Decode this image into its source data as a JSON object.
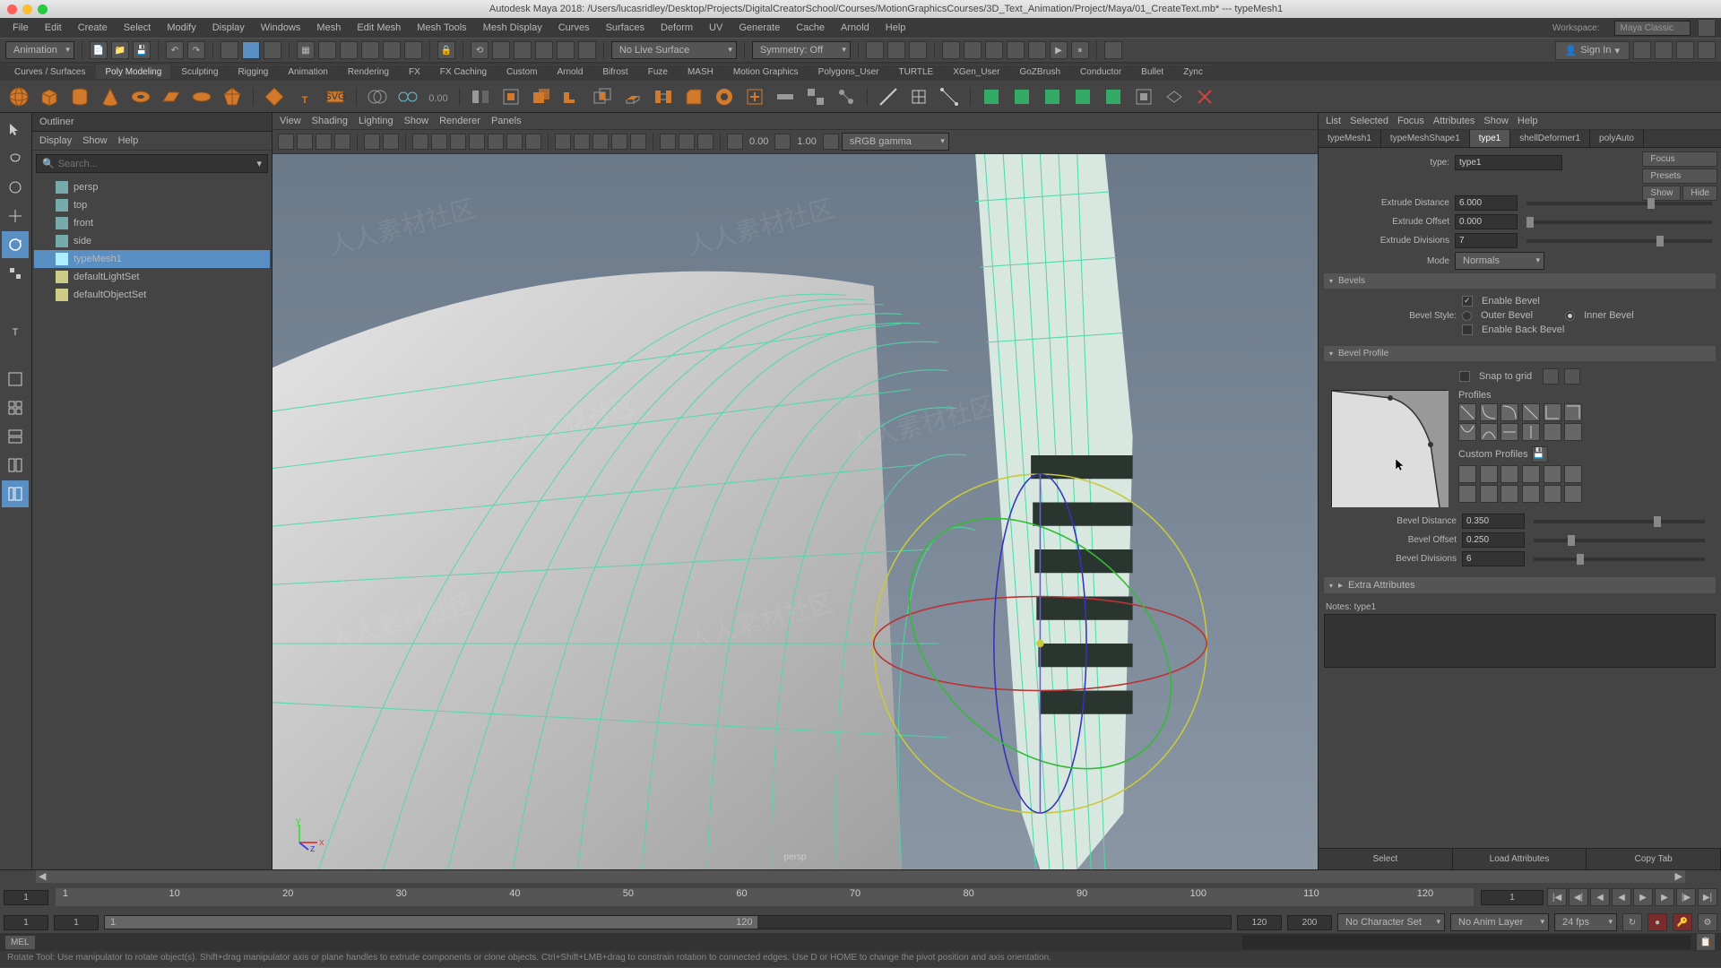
{
  "titlebar": {
    "text": "Autodesk Maya 2018: /Users/lucasridley/Desktop/Projects/DigitalCreatorSchool/Courses/MotionGraphicsCourses/3D_Text_Animation/Project/Maya/01_CreateText.mb*  ---  typeMesh1"
  },
  "menubar": {
    "items": [
      "File",
      "Edit",
      "Create",
      "Select",
      "Modify",
      "Display",
      "Windows",
      "Mesh",
      "Edit Mesh",
      "Mesh Tools",
      "Mesh Display",
      "Curves",
      "Surfaces",
      "Deform",
      "UV",
      "Generate",
      "Cache",
      "Arnold",
      "Help"
    ],
    "workspace_label": "Workspace:",
    "workspace_value": "Maya Classic"
  },
  "toolbar1": {
    "mode": "Animation",
    "live_surface": "No Live Surface",
    "symmetry": "Symmetry: Off",
    "signin": "Sign In"
  },
  "shelftabs": [
    "Curves / Surfaces",
    "Poly Modeling",
    "Sculpting",
    "Rigging",
    "Animation",
    "Rendering",
    "FX",
    "FX Caching",
    "Custom",
    "Arnold",
    "Bifrost",
    "Fuze",
    "MASH",
    "Motion Graphics",
    "Polygons_User",
    "TURTLE",
    "XGen_User",
    "GoZBrush",
    "Conductor",
    "Bullet",
    "Zync"
  ],
  "shelftab_active": "Poly Modeling",
  "outliner": {
    "title": "Outliner",
    "menu": [
      "Display",
      "Show",
      "Help"
    ],
    "search_placeholder": "Search...",
    "items": [
      {
        "name": "persp",
        "sel": false
      },
      {
        "name": "top",
        "sel": false
      },
      {
        "name": "front",
        "sel": false
      },
      {
        "name": "side",
        "sel": false
      },
      {
        "name": "typeMesh1",
        "sel": true
      },
      {
        "name": "defaultLightSet",
        "sel": false
      },
      {
        "name": "defaultObjectSet",
        "sel": false
      }
    ]
  },
  "viewport": {
    "menu": [
      "View",
      "Shading",
      "Lighting",
      "Show",
      "Renderer",
      "Panels"
    ],
    "exposure": "0.00",
    "gamma": "1.00",
    "colorspace": "sRGB gamma",
    "camera": "persp"
  },
  "attr": {
    "menu": [
      "List",
      "Selected",
      "Focus",
      "Attributes",
      "Show",
      "Help"
    ],
    "tabs": [
      "typeMesh1",
      "typeMeshShape1",
      "type1",
      "shellDeformer1",
      "polyAuto"
    ],
    "tab_active": "type1",
    "side_btns": [
      "Focus",
      "Presets",
      "Show",
      "Hide"
    ],
    "type_label": "type:",
    "type_value": "type1",
    "extrude_distance_label": "Extrude Distance",
    "extrude_distance": "6.000",
    "extrude_offset_label": "Extrude Offset",
    "extrude_offset": "0.000",
    "extrude_divisions_label": "Extrude Divisions",
    "extrude_divisions": "7",
    "mode_label": "Mode",
    "mode_value": "Normals",
    "bevels_hdr": "Bevels",
    "enable_bevel": "Enable Bevel",
    "bevel_style_label": "Bevel Style:",
    "outer_bevel": "Outer Bevel",
    "inner_bevel": "Inner Bevel",
    "enable_back_bevel": "Enable Back Bevel",
    "bevel_profile_hdr": "Bevel Profile",
    "snap_to_grid": "Snap to grid",
    "profiles_label": "Profiles",
    "custom_profiles_label": "Custom Profiles",
    "bevel_distance_label": "Bevel Distance",
    "bevel_distance": "0.350",
    "bevel_offset_label": "Bevel Offset",
    "bevel_offset": "0.250",
    "bevel_divisions_label": "Bevel Divisions",
    "bevel_divisions": "6",
    "extra_attrs": "Extra Attributes",
    "notes_label": "Notes: type1",
    "bottom": [
      "Select",
      "Load Attributes",
      "Copy Tab"
    ]
  },
  "timeline": {
    "start": "1",
    "current": "1",
    "range_start": "1",
    "range_end": "120",
    "end1": "120",
    "end2": "200",
    "char_set": "No Character Set",
    "anim_layer": "No Anim Layer",
    "fps": "24 fps",
    "ticks": [
      "1",
      "10",
      "20",
      "30",
      "40",
      "50",
      "60",
      "70",
      "80",
      "90",
      "100",
      "110",
      "120"
    ]
  },
  "cmdline": {
    "lang": "MEL"
  },
  "helpline": {
    "text": "Rotate Tool: Use manipulator to rotate object(s). Shift+drag manipulator axis or plane handles to extrude components or clone objects. Ctrl+Shift+LMB+drag to constrain rotation to connected edges. Use D or HOME to change the pivot position and axis orientation."
  },
  "watermark": "人人素材社区"
}
